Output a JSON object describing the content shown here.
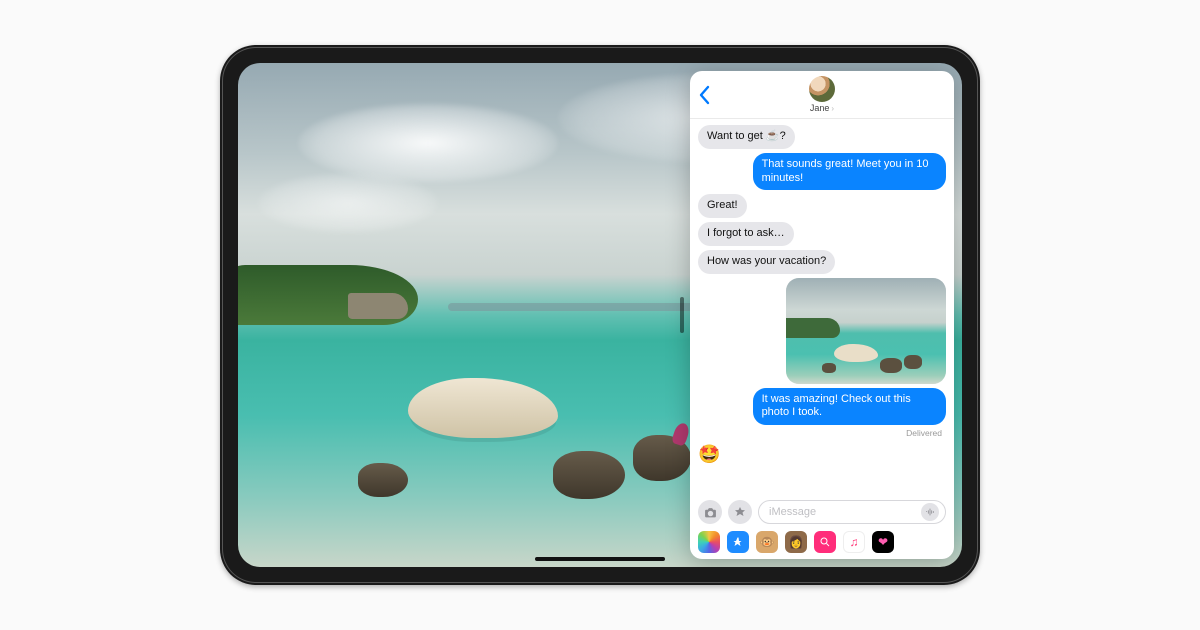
{
  "contact": {
    "name": "Jane",
    "chevron": "›"
  },
  "messages": {
    "m0": "Want to get ☕️?",
    "m1": "That sounds great! Meet you in 10 minutes!",
    "m2": "Great!",
    "m3": "I forgot to ask…",
    "m4": "How was your vacation?",
    "m5": "It was amazing! Check out this photo I took.",
    "delivered": "Delivered",
    "reaction": "🤩"
  },
  "compose": {
    "placeholder": "iMessage"
  },
  "icons": {
    "back": "‹",
    "camera": "camera-icon",
    "appstore": "appstore-icon",
    "mic": "waveform-icon"
  },
  "appstrip": {
    "photos": "Photos",
    "store": "App Store",
    "animoji1": "Animoji",
    "animoji2": "Memoji",
    "search": "#images",
    "music": "Music",
    "hearts": "Digital Touch"
  }
}
